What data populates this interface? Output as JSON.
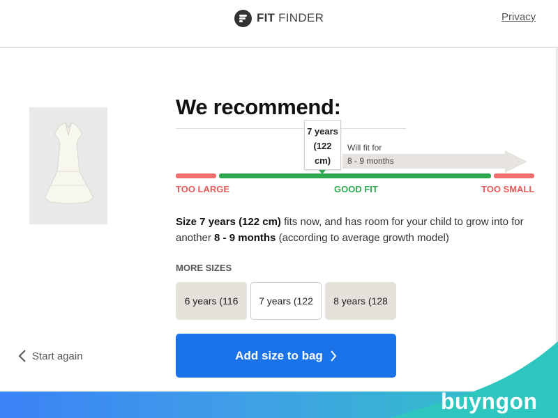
{
  "header": {
    "logo_bold": "FIT",
    "logo_light": "FINDER",
    "privacy_label": "Privacy"
  },
  "recommendation": {
    "title": "We recommend:",
    "size_callout": "7 years\n(122\ncm)",
    "will_fit_label": "Will fit for",
    "growth_months": "8 - 9 months",
    "fit_scale": {
      "too_large_label": "TOO LARGE",
      "good_fit_label": "GOOD FIT",
      "too_small_label": "TOO SMALL"
    },
    "description": {
      "size_bold": "Size 7 years (122 cm)",
      "text_1": " fits now, and has room for your child to grow into for another ",
      "months_bold": "8 - 9 months",
      "text_2": " (according to average growth model)"
    }
  },
  "more_sizes": {
    "heading": "MORE SIZES",
    "options": [
      {
        "label": "6 years (116",
        "selected": false
      },
      {
        "label": "7 years (122",
        "selected": true
      },
      {
        "label": "8 years (128",
        "selected": false
      }
    ]
  },
  "actions": {
    "start_again_label": "Start again",
    "add_to_bag_label": "Add size to bag"
  },
  "footer": {
    "brand_name": "buyngon"
  },
  "icons": {
    "logo": "fit-finder-logo-icon",
    "back": "chevron-left-icon",
    "forward": "chevron-right-icon"
  },
  "colors": {
    "accent_blue": "#1a73e8",
    "good_fit_green": "#2ea84f",
    "bad_fit_red": "#f07070",
    "size_option_bg": "#e5e2dc"
  }
}
